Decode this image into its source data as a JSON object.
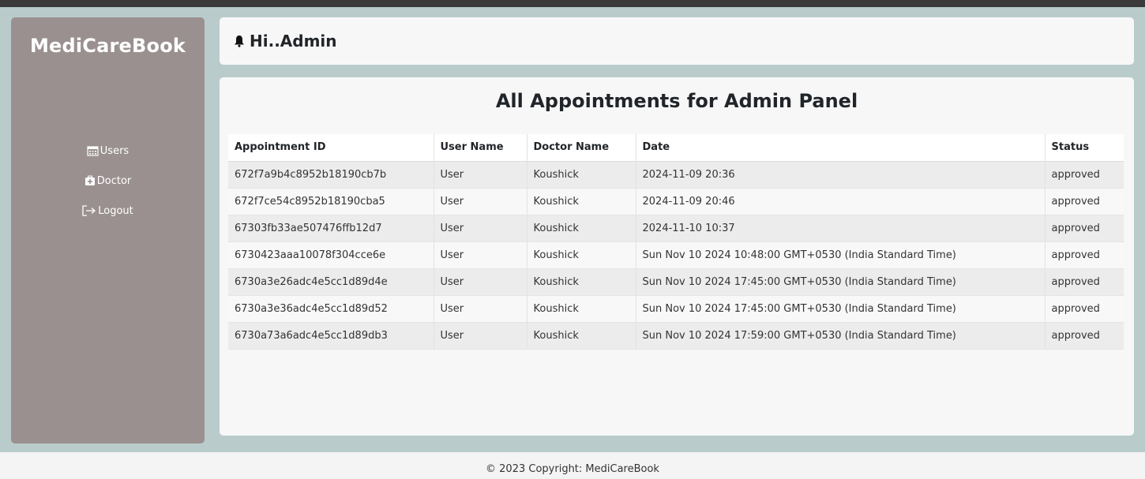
{
  "sidebar": {
    "brand": "MediCareBook",
    "items": [
      {
        "label": "Users",
        "icon": "calendar-icon"
      },
      {
        "label": "Doctor",
        "icon": "medical-kit-icon"
      },
      {
        "label": "Logout",
        "icon": "logout-icon"
      }
    ]
  },
  "header": {
    "title": "Hi..Admin",
    "icon": "bell-icon"
  },
  "main": {
    "title": "All Appointments for Admin Panel",
    "table": {
      "columns": [
        "Appointment ID",
        "User Name",
        "Doctor Name",
        "Date",
        "Status"
      ],
      "rows": [
        [
          "672f7a9b4c8952b18190cb7b",
          "User",
          "Koushick",
          "2024-11-09 20:36",
          "approved"
        ],
        [
          "672f7ce54c8952b18190cba5",
          "User",
          "Koushick",
          "2024-11-09 20:46",
          "approved"
        ],
        [
          "67303fb33ae507476ffb12d7",
          "User",
          "Koushick",
          "2024-11-10 10:37",
          "approved"
        ],
        [
          "6730423aaa10078f304cce6e",
          "User",
          "Koushick",
          "Sun Nov 10 2024 10:48:00 GMT+0530 (India Standard Time)",
          "approved"
        ],
        [
          "6730a3e26adc4e5cc1d89d4e",
          "User",
          "Koushick",
          "Sun Nov 10 2024 17:45:00 GMT+0530 (India Standard Time)",
          "approved"
        ],
        [
          "6730a3e36adc4e5cc1d89d52",
          "User",
          "Koushick",
          "Sun Nov 10 2024 17:45:00 GMT+0530 (India Standard Time)",
          "approved"
        ],
        [
          "6730a73a6adc4e5cc1d89db3",
          "User",
          "Koushick",
          "Sun Nov 10 2024 17:59:00 GMT+0530 (India Standard Time)",
          "approved"
        ]
      ]
    }
  },
  "footer": {
    "text": "© 2023 Copyright: MediCareBook"
  },
  "colors": {
    "sidebar": "#9a9090",
    "background": "#b9cccb",
    "panel": "#f7f7f7"
  }
}
